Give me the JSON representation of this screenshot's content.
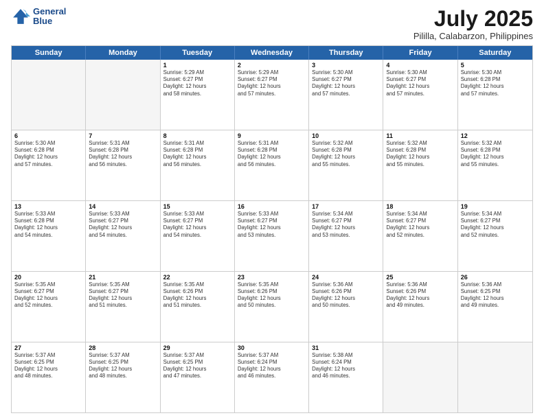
{
  "header": {
    "logo_line1": "General",
    "logo_line2": "Blue",
    "month": "July 2025",
    "location": "Pililla, Calabarzon, Philippines"
  },
  "weekdays": [
    "Sunday",
    "Monday",
    "Tuesday",
    "Wednesday",
    "Thursday",
    "Friday",
    "Saturday"
  ],
  "rows": [
    [
      {
        "day": "",
        "lines": [],
        "empty": true
      },
      {
        "day": "",
        "lines": [],
        "empty": true
      },
      {
        "day": "1",
        "lines": [
          "Sunrise: 5:29 AM",
          "Sunset: 6:27 PM",
          "Daylight: 12 hours",
          "and 58 minutes."
        ]
      },
      {
        "day": "2",
        "lines": [
          "Sunrise: 5:29 AM",
          "Sunset: 6:27 PM",
          "Daylight: 12 hours",
          "and 57 minutes."
        ]
      },
      {
        "day": "3",
        "lines": [
          "Sunrise: 5:30 AM",
          "Sunset: 6:27 PM",
          "Daylight: 12 hours",
          "and 57 minutes."
        ]
      },
      {
        "day": "4",
        "lines": [
          "Sunrise: 5:30 AM",
          "Sunset: 6:27 PM",
          "Daylight: 12 hours",
          "and 57 minutes."
        ]
      },
      {
        "day": "5",
        "lines": [
          "Sunrise: 5:30 AM",
          "Sunset: 6:28 PM",
          "Daylight: 12 hours",
          "and 57 minutes."
        ]
      }
    ],
    [
      {
        "day": "6",
        "lines": [
          "Sunrise: 5:30 AM",
          "Sunset: 6:28 PM",
          "Daylight: 12 hours",
          "and 57 minutes."
        ]
      },
      {
        "day": "7",
        "lines": [
          "Sunrise: 5:31 AM",
          "Sunset: 6:28 PM",
          "Daylight: 12 hours",
          "and 56 minutes."
        ]
      },
      {
        "day": "8",
        "lines": [
          "Sunrise: 5:31 AM",
          "Sunset: 6:28 PM",
          "Daylight: 12 hours",
          "and 56 minutes."
        ]
      },
      {
        "day": "9",
        "lines": [
          "Sunrise: 5:31 AM",
          "Sunset: 6:28 PM",
          "Daylight: 12 hours",
          "and 56 minutes."
        ]
      },
      {
        "day": "10",
        "lines": [
          "Sunrise: 5:32 AM",
          "Sunset: 6:28 PM",
          "Daylight: 12 hours",
          "and 55 minutes."
        ]
      },
      {
        "day": "11",
        "lines": [
          "Sunrise: 5:32 AM",
          "Sunset: 6:28 PM",
          "Daylight: 12 hours",
          "and 55 minutes."
        ]
      },
      {
        "day": "12",
        "lines": [
          "Sunrise: 5:32 AM",
          "Sunset: 6:28 PM",
          "Daylight: 12 hours",
          "and 55 minutes."
        ]
      }
    ],
    [
      {
        "day": "13",
        "lines": [
          "Sunrise: 5:33 AM",
          "Sunset: 6:28 PM",
          "Daylight: 12 hours",
          "and 54 minutes."
        ]
      },
      {
        "day": "14",
        "lines": [
          "Sunrise: 5:33 AM",
          "Sunset: 6:27 PM",
          "Daylight: 12 hours",
          "and 54 minutes."
        ]
      },
      {
        "day": "15",
        "lines": [
          "Sunrise: 5:33 AM",
          "Sunset: 6:27 PM",
          "Daylight: 12 hours",
          "and 54 minutes."
        ]
      },
      {
        "day": "16",
        "lines": [
          "Sunrise: 5:33 AM",
          "Sunset: 6:27 PM",
          "Daylight: 12 hours",
          "and 53 minutes."
        ]
      },
      {
        "day": "17",
        "lines": [
          "Sunrise: 5:34 AM",
          "Sunset: 6:27 PM",
          "Daylight: 12 hours",
          "and 53 minutes."
        ]
      },
      {
        "day": "18",
        "lines": [
          "Sunrise: 5:34 AM",
          "Sunset: 6:27 PM",
          "Daylight: 12 hours",
          "and 52 minutes."
        ]
      },
      {
        "day": "19",
        "lines": [
          "Sunrise: 5:34 AM",
          "Sunset: 6:27 PM",
          "Daylight: 12 hours",
          "and 52 minutes."
        ]
      }
    ],
    [
      {
        "day": "20",
        "lines": [
          "Sunrise: 5:35 AM",
          "Sunset: 6:27 PM",
          "Daylight: 12 hours",
          "and 52 minutes."
        ]
      },
      {
        "day": "21",
        "lines": [
          "Sunrise: 5:35 AM",
          "Sunset: 6:27 PM",
          "Daylight: 12 hours",
          "and 51 minutes."
        ]
      },
      {
        "day": "22",
        "lines": [
          "Sunrise: 5:35 AM",
          "Sunset: 6:26 PM",
          "Daylight: 12 hours",
          "and 51 minutes."
        ]
      },
      {
        "day": "23",
        "lines": [
          "Sunrise: 5:35 AM",
          "Sunset: 6:26 PM",
          "Daylight: 12 hours",
          "and 50 minutes."
        ]
      },
      {
        "day": "24",
        "lines": [
          "Sunrise: 5:36 AM",
          "Sunset: 6:26 PM",
          "Daylight: 12 hours",
          "and 50 minutes."
        ]
      },
      {
        "day": "25",
        "lines": [
          "Sunrise: 5:36 AM",
          "Sunset: 6:26 PM",
          "Daylight: 12 hours",
          "and 49 minutes."
        ]
      },
      {
        "day": "26",
        "lines": [
          "Sunrise: 5:36 AM",
          "Sunset: 6:25 PM",
          "Daylight: 12 hours",
          "and 49 minutes."
        ]
      }
    ],
    [
      {
        "day": "27",
        "lines": [
          "Sunrise: 5:37 AM",
          "Sunset: 6:25 PM",
          "Daylight: 12 hours",
          "and 48 minutes."
        ]
      },
      {
        "day": "28",
        "lines": [
          "Sunrise: 5:37 AM",
          "Sunset: 6:25 PM",
          "Daylight: 12 hours",
          "and 48 minutes."
        ]
      },
      {
        "day": "29",
        "lines": [
          "Sunrise: 5:37 AM",
          "Sunset: 6:25 PM",
          "Daylight: 12 hours",
          "and 47 minutes."
        ]
      },
      {
        "day": "30",
        "lines": [
          "Sunrise: 5:37 AM",
          "Sunset: 6:24 PM",
          "Daylight: 12 hours",
          "and 46 minutes."
        ]
      },
      {
        "day": "31",
        "lines": [
          "Sunrise: 5:38 AM",
          "Sunset: 6:24 PM",
          "Daylight: 12 hours",
          "and 46 minutes."
        ]
      },
      {
        "day": "",
        "lines": [],
        "empty": true
      },
      {
        "day": "",
        "lines": [],
        "empty": true
      }
    ]
  ]
}
